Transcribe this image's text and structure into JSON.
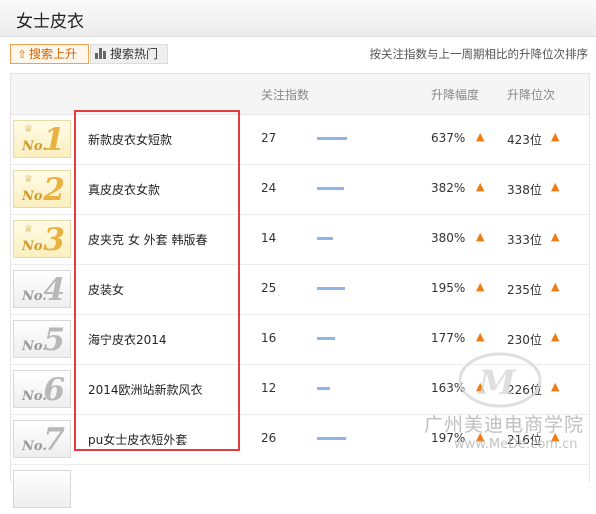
{
  "header": {
    "title": "女士皮衣"
  },
  "tabs": [
    {
      "label": "搜索上升",
      "icon": "up-arrow-icon",
      "active": true
    },
    {
      "label": "搜索热门",
      "icon": "bar-chart-icon",
      "active": false
    }
  ],
  "hint": "按关注指数与上一周期相比的升降位次排序",
  "columns": {
    "index": "关注指数",
    "change": "升降幅度",
    "rank_change": "升降位次"
  },
  "colors": {
    "accent": "#f07a14",
    "bar": "#8fb6e6",
    "highlight_box": "#e23c3c",
    "gold": "#e8b140"
  },
  "rows": [
    {
      "no": "No.",
      "rank": "1",
      "keyword": "新款皮衣女短款",
      "index": "27",
      "change": "637%",
      "rank_change": "423位"
    },
    {
      "no": "No.",
      "rank": "2",
      "keyword": "真皮皮衣女款",
      "index": "24",
      "change": "382%",
      "rank_change": "338位"
    },
    {
      "no": "No.",
      "rank": "3",
      "keyword": "皮夹克 女 外套 韩版春",
      "index": "14",
      "change": "380%",
      "rank_change": "333位"
    },
    {
      "no": "No.",
      "rank": "4",
      "keyword": "皮装女",
      "index": "25",
      "change": "195%",
      "rank_change": "235位"
    },
    {
      "no": "No.",
      "rank": "5",
      "keyword": "海宁皮衣2014",
      "index": "16",
      "change": "177%",
      "rank_change": "230位"
    },
    {
      "no": "No.",
      "rank": "6",
      "keyword": "2014欧洲站新款风衣",
      "index": "12",
      "change": "163%",
      "rank_change": "226位"
    },
    {
      "no": "No.",
      "rank": "7",
      "keyword": "pu女士皮衣短外套",
      "index": "26",
      "change": "197%",
      "rank_change": "216位"
    }
  ],
  "watermark": {
    "line1": "广州美迪电商学院",
    "line2": "www.MeDe.com.cn"
  }
}
